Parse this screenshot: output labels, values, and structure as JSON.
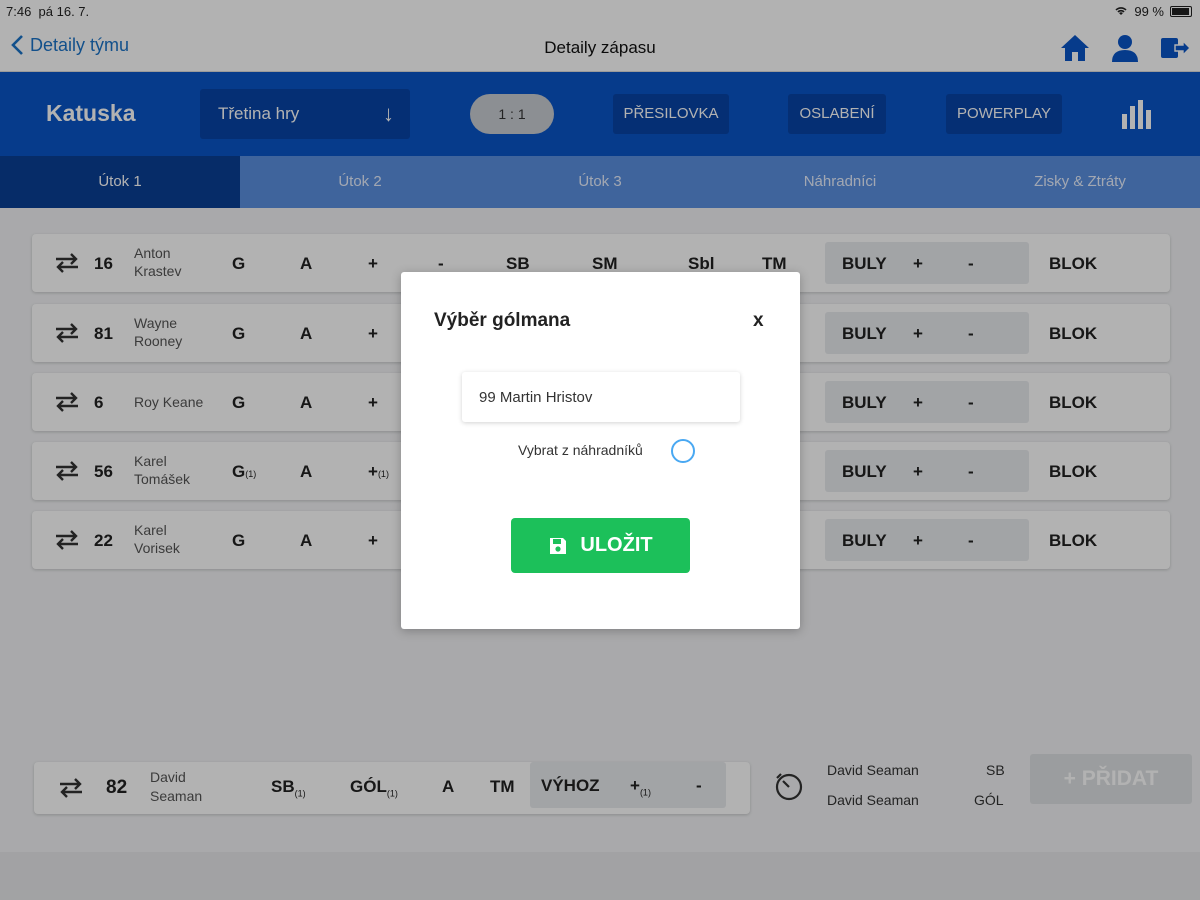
{
  "status": {
    "time": "7:46",
    "date": "pá 16. 7.",
    "battery": "99 %"
  },
  "nav": {
    "back_label": "Detaily týmu",
    "title": "Detaily zápasu"
  },
  "team": {
    "name": "Katuska",
    "period_select": "Třetina hry",
    "score": "1 : 1",
    "buttons": [
      "PŘESILOVKA",
      "OSLABENÍ",
      "POWERPLAY"
    ]
  },
  "tabs": [
    "Útok 1",
    "Útok 2",
    "Útok 3",
    "Náhradníci",
    "Zisky & Ztráty"
  ],
  "rows": [
    {
      "number": "16",
      "name": [
        "Anton",
        "Krastev"
      ],
      "g": "G",
      "a": "A",
      "plus": "+",
      "minus": "-",
      "sb": "SB",
      "sm": "SM",
      "sbl": "Sbl",
      "tm": "TM",
      "buly": "BULY",
      "buly_plus": "+",
      "buly_minus": "-",
      "blok": "BLOK"
    },
    {
      "number": "81",
      "name": [
        "Wayne",
        "Rooney"
      ],
      "g": "G",
      "a": "A",
      "plus": "+",
      "buly": "BULY",
      "buly_plus": "+",
      "buly_minus": "-",
      "blok": "BLOK"
    },
    {
      "number": "6",
      "name": [
        "Roy Keane"
      ],
      "g": "G",
      "a": "A",
      "plus": "+",
      "buly": "BULY",
      "buly_plus": "+",
      "buly_minus": "-",
      "blok": "BLOK"
    },
    {
      "number": "56",
      "name": [
        "Karel",
        "Tomášek"
      ],
      "g": "G",
      "g_count": "(1)",
      "a": "A",
      "plus": "+",
      "plus_count": "(1)",
      "buly": "BULY",
      "buly_plus": "+",
      "buly_minus": "-",
      "blok": "BLOK"
    },
    {
      "number": "22",
      "name": [
        "Karel",
        "Vorisek"
      ],
      "g": "G",
      "a": "A",
      "plus": "+",
      "buly": "BULY",
      "buly_plus": "+",
      "buly_minus": "-",
      "blok": "BLOK"
    }
  ],
  "goalie": {
    "number": "82",
    "name": [
      "David",
      "Seaman"
    ],
    "sb": "SB",
    "sb_count": "(1)",
    "gol": "GÓL",
    "gol_count": "(1)",
    "a": "A",
    "tm": "TM",
    "vyhoz": "VÝHOZ",
    "vyhoz_plus": "+",
    "vyhoz_plus_count": "(1)",
    "vyhoz_minus": "-"
  },
  "events": [
    {
      "player": "David Seaman",
      "type": "SB"
    },
    {
      "player": "David Seaman",
      "type": "GÓL"
    }
  ],
  "add_button": "+ PŘIDAT",
  "modal": {
    "title": "Výběr gólmana",
    "close": "x",
    "selected_goalie": "99 Martin Hristov",
    "substitutes_label": "Vybrat z náhradníků",
    "save_label": "ULOŽIT"
  },
  "colors": {
    "primary": "#0a55c8",
    "tab_active": "#0a3f96",
    "save": "#1cc05a"
  }
}
